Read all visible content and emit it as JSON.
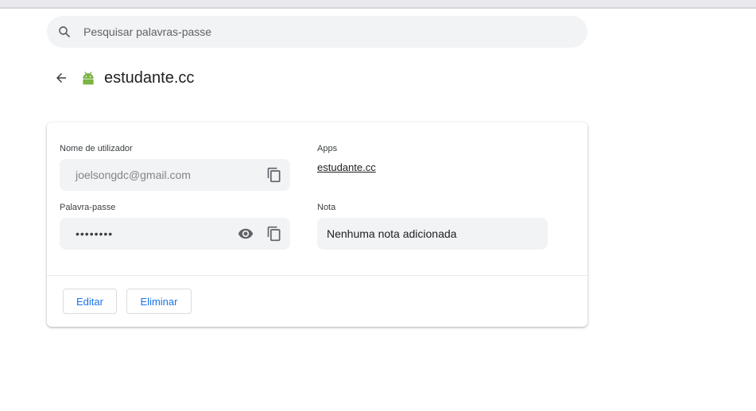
{
  "search": {
    "placeholder": "Pesquisar palavras-passe",
    "icon": "search-icon"
  },
  "header": {
    "title": "estudante.cc",
    "back_icon": "arrow-back-icon",
    "app_icon": "android-icon"
  },
  "details": {
    "username_label": "Nome de utilizador",
    "username_value": "joelsongdc@gmail.com",
    "apps_label": "Apps",
    "apps_value": "estudante.cc",
    "password_label": "Palavra-passe",
    "password_value": "••••••••",
    "note_label": "Nota",
    "note_value": "Nenhuma nota adicionada"
  },
  "actions": {
    "edit_label": "Editar",
    "delete_label": "Eliminar"
  },
  "colors": {
    "accent": "#1a73e8",
    "field_bg": "#f1f3f4",
    "android_green": "#7cb342"
  }
}
